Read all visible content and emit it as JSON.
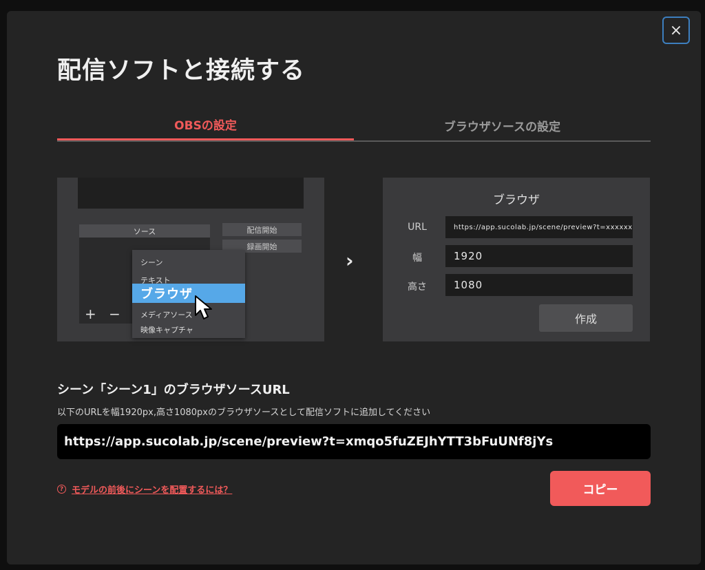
{
  "dialog": {
    "title": "配信ソフトと接続する",
    "close_label": "×"
  },
  "tabs": [
    {
      "label": "OBSの設定",
      "active": true
    },
    {
      "label": "ブラウザソースの設定",
      "active": false
    }
  ],
  "obs_illustration": {
    "sources_header": "ソース",
    "start_stream": "配信開始",
    "start_record": "録画開始",
    "plus_minus": "+ −",
    "menu_items": [
      "シーン",
      "テキスト",
      "ブラウザ",
      "メディアソース",
      "映像キャプチャ"
    ],
    "selected_item": "ブラウザ"
  },
  "arrow": "›",
  "browser_illustration": {
    "title": "ブラウザ",
    "url_label": "URL",
    "url_value": "https://app.sucolab.jp/scene/preview?t=xxxxxx",
    "width_label": "幅",
    "width_value": "1920",
    "height_label": "高さ",
    "height_value": "1080",
    "create_label": "作成"
  },
  "section": {
    "heading": "シーン「シーン1」のブラウザソースURL",
    "description": "以下のURLを幅1920px,高さ1080pxのブラウザソースとして配信ソフトに追加してください",
    "url": "https://app.sucolab.jp/scene/preview?t=xmqo5fuZEJhYTT3bFuUNf8jYs"
  },
  "help": {
    "icon": "?",
    "link_text": "モデルの前後にシーンを配置するには？"
  },
  "copy_label": "コピー",
  "colors": {
    "accent": "#f15a5a",
    "selected_blue": "#56a8e8",
    "focus_border": "#3d7fbf"
  }
}
